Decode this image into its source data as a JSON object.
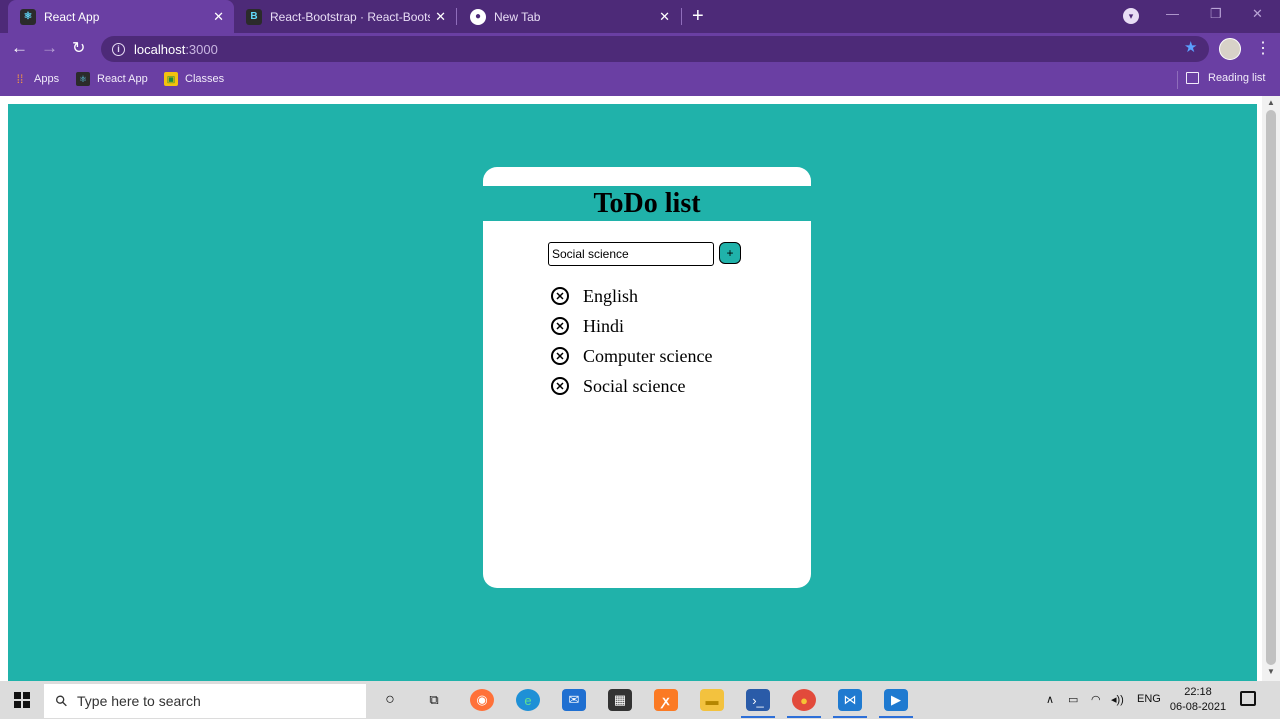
{
  "browser": {
    "tabs": [
      {
        "title": "React App",
        "favicon": "react-logo-icon",
        "active": true
      },
      {
        "title": "React-Bootstrap · React-Bootstrap",
        "favicon": "react-bootstrap-logo-icon",
        "active": false
      },
      {
        "title": "New Tab",
        "favicon": "chrome-logo-icon",
        "active": false
      }
    ],
    "new_tab_label": "+",
    "url_host": "localhost",
    "url_port": ":3000",
    "bookmarks": [
      {
        "label": "Apps",
        "icon": "apps-grid-icon"
      },
      {
        "label": "React App",
        "icon": "react-logo-icon"
      },
      {
        "label": "Classes",
        "icon": "classroom-icon"
      }
    ],
    "reading_list_label": "Reading list",
    "colors": {
      "frame": "#4d2a78",
      "toolbar": "#6a3fa3"
    }
  },
  "app": {
    "title": "ToDo list",
    "input_value": "Social science",
    "add_button_label": "+",
    "items": [
      "English",
      "Hindi",
      "Computer science",
      "Social science"
    ],
    "delete_icon_glyph": "✕",
    "colors": {
      "background": "#20b2aa",
      "card": "#ffffff"
    }
  },
  "taskbar": {
    "search_placeholder": "Type here to search",
    "language": "ENG",
    "time": "22:18",
    "date": "06-08-2021",
    "pinned_apps": [
      "cortana-icon",
      "task-view-icon",
      "firefox-icon",
      "edge-icon",
      "mail-icon",
      "store-icon",
      "xampp-icon",
      "file-explorer-icon",
      "powershell-icon",
      "chrome-icon",
      "vscode-icon",
      "media-player-icon"
    ]
  }
}
